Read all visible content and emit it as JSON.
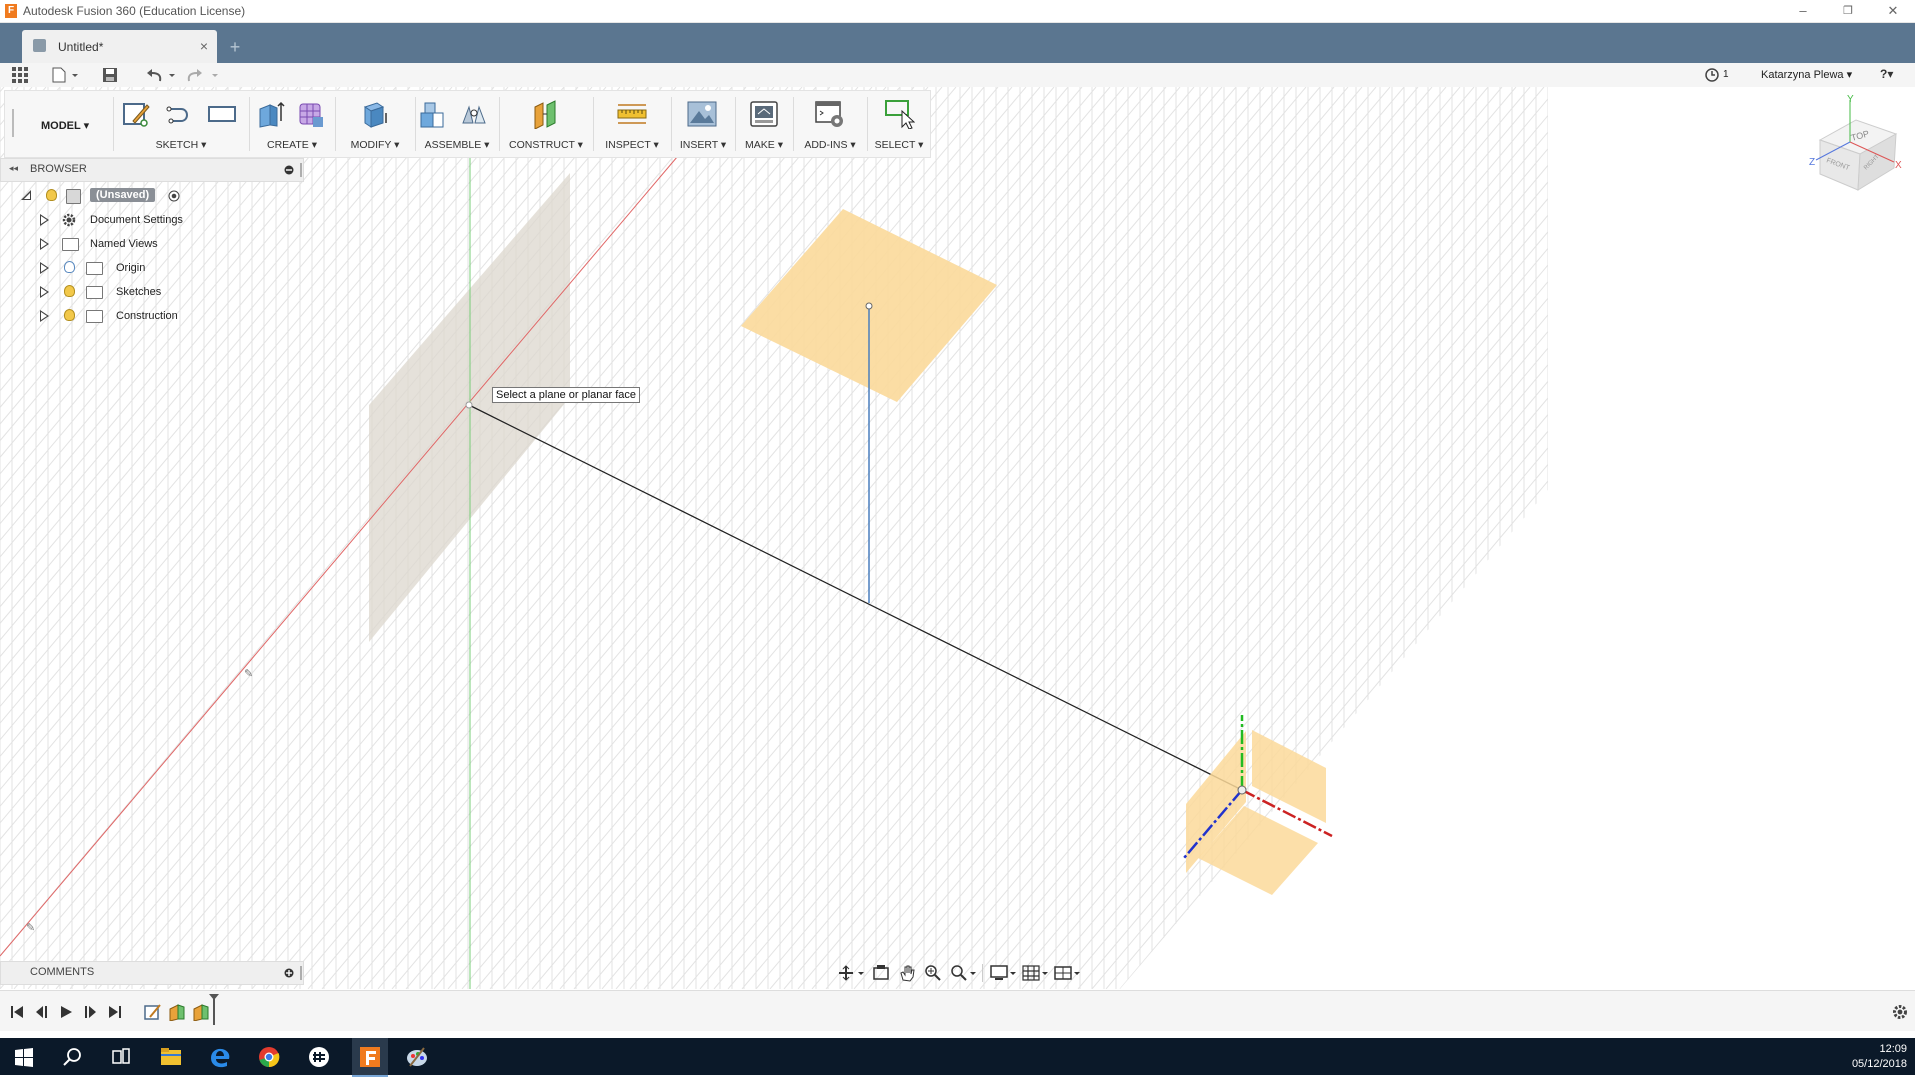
{
  "window": {
    "title": "Autodesk Fusion 360 (Education License)",
    "app_icon_letter": "F",
    "minimize": "–",
    "restore": "❐",
    "close": "✕"
  },
  "tabs": {
    "active_label": "Untitled*",
    "close": "×",
    "new_tab": "+"
  },
  "quickbar": {
    "jobs_count": "1",
    "user_name": "Katarzyna Plewa ▾",
    "help": "?▾"
  },
  "toolbar": {
    "workspace": "MODEL ▾",
    "groups": {
      "sketch": "SKETCH ▾",
      "create": "CREATE ▾",
      "modify": "MODIFY ▾",
      "assemble": "ASSEMBLE ▾",
      "construct": "CONSTRUCT ▾",
      "inspect": "INSPECT ▾",
      "insert": "INSERT ▾",
      "make": "MAKE ▾",
      "addins": "ADD-INS ▾",
      "select": "SELECT ▾"
    }
  },
  "browser": {
    "title": "BROWSER",
    "collapse": "◂◂",
    "root": "(Unsaved)",
    "items": [
      {
        "label": "Document Settings"
      },
      {
        "label": "Named Views"
      },
      {
        "label": "Origin"
      },
      {
        "label": "Sketches"
      },
      {
        "label": "Construction"
      }
    ]
  },
  "viewcube": {
    "top": "TOP",
    "front": "FRONT",
    "right": "RIGHT",
    "axis_x": "X",
    "axis_y": "Y",
    "axis_z": "Z"
  },
  "viewport": {
    "tooltip": "Select a plane or planar face"
  },
  "comments": {
    "title": "COMMENTS"
  },
  "taskbar": {
    "time": "12:09",
    "date": "05/12/2018"
  },
  "colors": {
    "tab_bar": "#5b7690",
    "plane_orange": "#fbd99a",
    "plane_grey": "#dcd7ce",
    "taskbar": "#0b1929"
  }
}
